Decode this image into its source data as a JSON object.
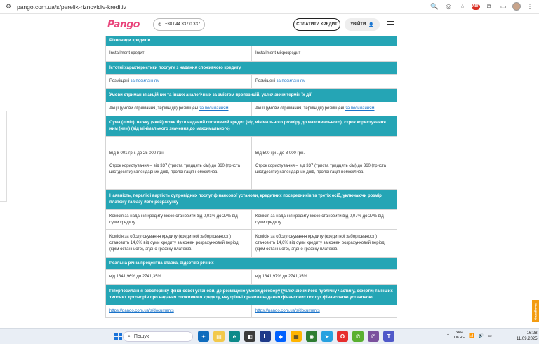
{
  "browser": {
    "url": "pango.com.ua/s/perelik-riznovidiv-kreditiv"
  },
  "header": {
    "logo": "Pango",
    "phone": "+38 044 337 0 337",
    "pay_button": "СПЛАТИТИ КРЕДИТ",
    "login_button": "УВІЙТИ"
  },
  "table": {
    "sec1_title": "Різновиди кредитів",
    "sec1_left": "Installment кредит",
    "sec1_right": "Installment мікрокредит",
    "sec2_title": "Істотні характеристики послуги з надання споживчого кредиту",
    "sec2_text": "Розміщені",
    "link_label": "за посиланням",
    "sec3_title": "Умови отримання акційних та інших аналогічних за змістом пропозицій, уключаючи термін їх дії",
    "sec3_text": "Акції (умови отримання, термін дії) розміщені",
    "sec4_title": "Сума (ліміт), на яку (який) може бути наданий споживчий кредит (від мінімального розміру до максимального), строк користування ним (ним) (від мінімального значення до максимального)",
    "sec4_left_sum": "Від 8 001 грн. до 25 000 грн.",
    "sec4_left_term": "Строк користування – від 337 (триста тридцять сім) до 360 (триста шістдесяти) календарних днів, пролонгація неможлива",
    "sec4_right_sum": "Від 500 грн. до 8 000 грн.",
    "sec4_right_term": "Строк користування – від 337 (триста тридцять сім) до 360 (триста шістдесяти) календарних днів, пролонгація неможлива",
    "sec5_title": "Наявність, перелік і вартість супровідних послуг фінансової установи, кредитних посередників та третіх осіб, уключаючи розмір платежу та базу його розрахунку",
    "sec5_left_fee1": "Комісія за надання кредиту може становити від 0,01% до 27% від суми кредиту.",
    "sec5_right_fee1": "Комісія за надання кредиту може становити від 0,07% до 27% від суми кредиту.",
    "sec5_left_fee2": "Комісія за обслуговування кредиту (кредитної заборгованості) становить 14,6% від суми кредиту за кожен розрахунковий період (крім останнього), згідно графіку платежів.",
    "sec5_right_fee2": "Комісія за обслуговування кредиту (кредитної заборгованості) становить 14,6% від суми кредиту за кожен розрахунковий період (крім останнього), згідно графіку платежів.",
    "sec6_title": "Реальна річна процентна ставка, відсотків річних",
    "sec6_left": "від 1341,96% до 2741,35%",
    "sec6_right": "від 1341,97% до 2741,35%",
    "sec7_title": "Гіперпосилання вебсторінку фінансової установи, де розміщено умови договору (уключаючи його публічну частину, оферти) та інших типових договорів про надання споживчого кредиту, внутрішні правила надання фінансових послуг фінансовою установою",
    "sec7_link": "https://pango.com.ua/s/documents"
  },
  "feedback_tab": "Онлайн-чат",
  "taskbar": {
    "search_placeholder": "Пошук",
    "lang_top": "УКР",
    "lang_bottom": "UKRE",
    "time": "16:28",
    "date": "11.09.2025"
  },
  "colors": {
    "accent_teal": "#25a5b5",
    "brand_pink": "#e9437a",
    "link_blue": "#1a73c9"
  }
}
